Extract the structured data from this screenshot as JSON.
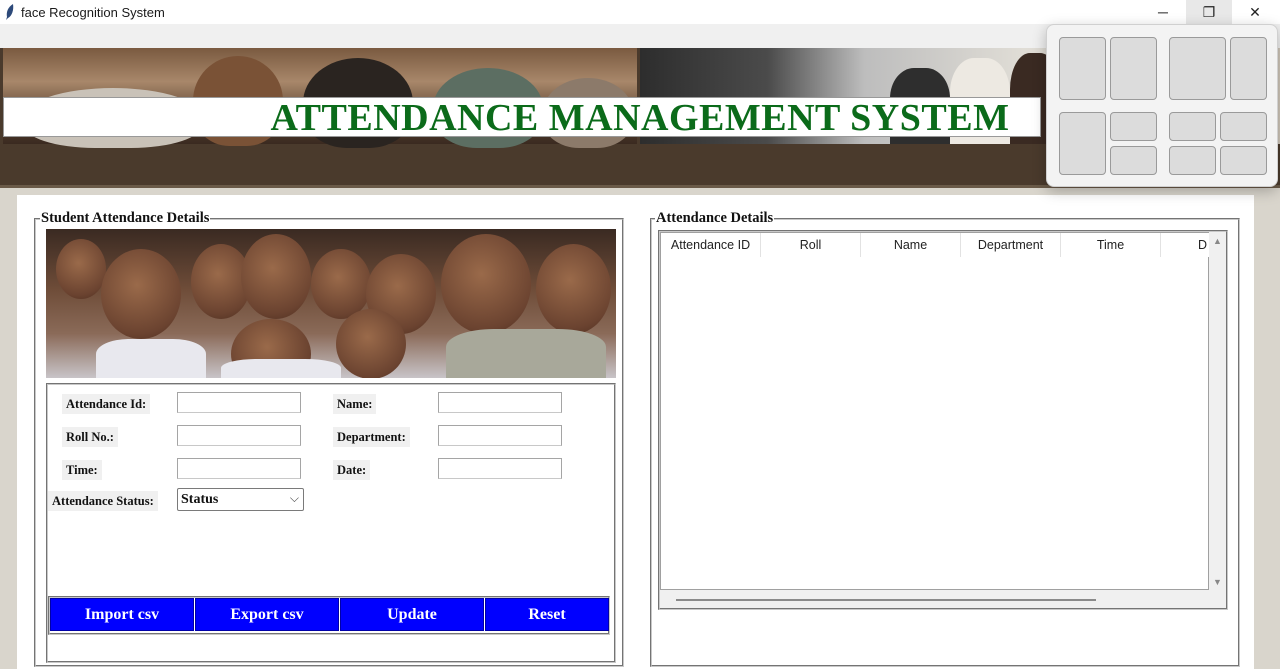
{
  "window": {
    "title": "face Recognition System",
    "icon": "feather-icon",
    "controls": {
      "minimize": "─",
      "maximize": "❐",
      "close": "✕"
    }
  },
  "banner": {
    "title": "ATTENDANCE MANAGEMENT SYSTEM"
  },
  "left_panel": {
    "title": "Student Attendance Details",
    "fields": {
      "attendance_id": {
        "label": "Attendance Id:",
        "value": ""
      },
      "name": {
        "label": "Name:",
        "value": ""
      },
      "roll_no": {
        "label": "Roll No.:",
        "value": ""
      },
      "department": {
        "label": "Department:",
        "value": ""
      },
      "time": {
        "label": "Time:",
        "value": ""
      },
      "date": {
        "label": "Date:",
        "value": ""
      },
      "attendance_status": {
        "label": "Attendance Status:",
        "selected": "Status"
      }
    },
    "buttons": {
      "import_csv": "Import csv",
      "export_csv": "Export csv",
      "update": "Update",
      "reset": "Reset"
    }
  },
  "right_panel": {
    "title": "Attendance Details",
    "table": {
      "columns": [
        "Attendance ID",
        "Roll",
        "Name",
        "Department",
        "Time",
        "D"
      ],
      "rows": []
    }
  },
  "colors": {
    "banner_title": "#0b6b1a",
    "button_bg": "#0000ff",
    "button_text": "#ffffff"
  }
}
